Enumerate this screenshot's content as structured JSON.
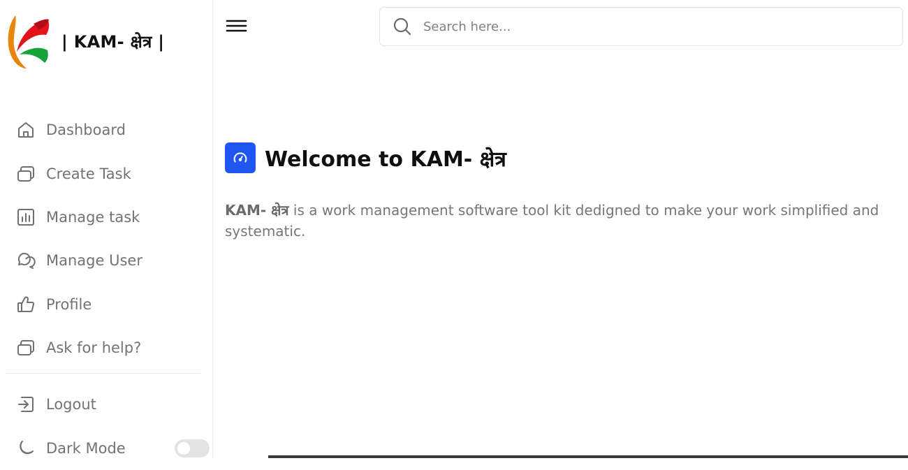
{
  "brand": {
    "name": "| KAM- क्षेत्र |"
  },
  "sidebar": {
    "items": [
      {
        "label": "Dashboard",
        "icon": "home-icon"
      },
      {
        "label": "Create Task",
        "icon": "layers-icon"
      },
      {
        "label": "Manage task",
        "icon": "bar-chart-icon"
      },
      {
        "label": "Manage User",
        "icon": "chat-bubbles-icon"
      },
      {
        "label": "Profile",
        "icon": "thumbs-up-icon"
      },
      {
        "label": "Ask for help?",
        "icon": "layers-icon"
      }
    ],
    "bottom_items": [
      {
        "label": "Logout",
        "icon": "logout-icon"
      },
      {
        "label": "Dark Mode",
        "icon": "moon-icon"
      }
    ],
    "dark_mode_on": false
  },
  "search": {
    "placeholder": "Search here..."
  },
  "main": {
    "title": "Welcome to KAM- क्षेत्र",
    "description_strong": "KAM- क्षेत्र",
    "description_rest": " is a work management software tool kit dedigned to make your work simplified and systematic."
  },
  "colors": {
    "accent": "#1f56f0",
    "text_muted": "#737373",
    "logo_red": "#e3131b",
    "logo_green": "#18a33a",
    "logo_orange": "#e8860c"
  }
}
